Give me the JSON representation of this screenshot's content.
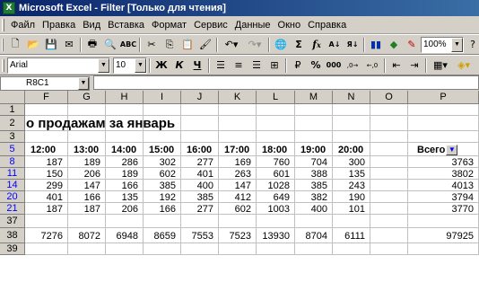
{
  "window": {
    "title": "Microsoft Excel - Filter  [Только для чтения]"
  },
  "menu": [
    "Файл",
    "Правка",
    "Вид",
    "Вставка",
    "Формат",
    "Сервис",
    "Данные",
    "Окно",
    "Справка"
  ],
  "toolbar1": {
    "zoom": "100%",
    "buttons": [
      "new-icon",
      "open-icon",
      "save-icon",
      "mail-icon",
      "print-icon",
      "print-preview-icon",
      "spelling-icon",
      "cut-icon",
      "copy-icon",
      "paste-icon",
      "format-painter-icon",
      "undo-icon",
      "redo-icon",
      "hyperlink-icon",
      "autosum-icon",
      "function-icon",
      "sort-ascending-icon",
      "sort-descending-icon",
      "chart-wizard-icon",
      "map-icon"
    ]
  },
  "toolbar2": {
    "font_name": "Arial",
    "font_size": "10",
    "bold": "Ж",
    "italic": "К",
    "underline": "Ч",
    "currency": "₽",
    "percent": "%",
    "thousands": "000",
    "inc_decimal": ",0→",
    "dec_decimal": "←,0"
  },
  "formula": {
    "name_box": "R8C1",
    "content": ""
  },
  "grid": {
    "columns": [
      "F",
      "G",
      "H",
      "I",
      "J",
      "K",
      "L",
      "M",
      "N",
      "O",
      "P"
    ],
    "title_text": "о продажам за январь",
    "header_row": [
      "12:00",
      "13:00",
      "14:00",
      "15:00",
      "16:00",
      "17:00",
      "18:00",
      "19:00",
      "20:00",
      "",
      "Всего"
    ],
    "rows": [
      {
        "num": "1",
        "cells": []
      },
      {
        "num": "2",
        "cells": []
      },
      {
        "num": "3",
        "cells": []
      },
      {
        "num": "5",
        "cells": []
      },
      {
        "num": "8",
        "cells": [
          "187",
          "189",
          "286",
          "302",
          "277",
          "169",
          "760",
          "704",
          "300",
          "",
          "3763"
        ]
      },
      {
        "num": "11",
        "cells": [
          "150",
          "206",
          "189",
          "602",
          "401",
          "263",
          "601",
          "388",
          "135",
          "",
          "3802"
        ]
      },
      {
        "num": "14",
        "cells": [
          "299",
          "147",
          "166",
          "385",
          "400",
          "147",
          "1028",
          "385",
          "243",
          "",
          "4013"
        ]
      },
      {
        "num": "20",
        "cells": [
          "401",
          "166",
          "135",
          "192",
          "385",
          "412",
          "649",
          "382",
          "190",
          "",
          "3794"
        ]
      },
      {
        "num": "21",
        "cells": [
          "187",
          "187",
          "206",
          "166",
          "277",
          "602",
          "1003",
          "400",
          "101",
          "",
          "3770"
        ]
      },
      {
        "num": "37",
        "cells": []
      },
      {
        "num": "38",
        "cells": [
          "7276",
          "8072",
          "6948",
          "8659",
          "7553",
          "7523",
          "13930",
          "8704",
          "6111",
          "",
          "97925"
        ]
      },
      {
        "num": "39",
        "cells": []
      }
    ]
  }
}
